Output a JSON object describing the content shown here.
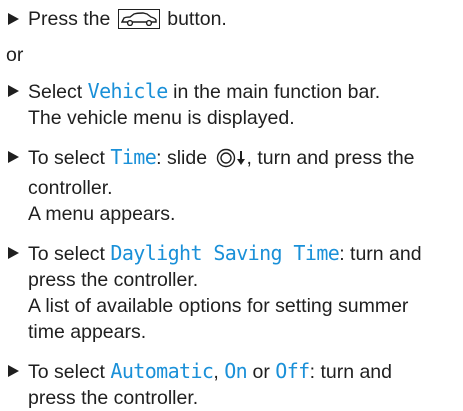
{
  "steps": [
    {
      "pre": "Press the",
      "post": "button.",
      "icon": "car-button-icon"
    },
    {
      "or_label": "or"
    },
    {
      "pre": "Select",
      "term": "Vehicle",
      "post": "in the main function bar.",
      "result": "The vehicle menu is displayed."
    },
    {
      "pre": "To select",
      "term": "Time",
      "mid": ": slide",
      "post": ", turn and press the",
      "cont": "controller.",
      "result": "A menu appears.",
      "icon": "controller-slide-down-icon"
    },
    {
      "pre": "To select",
      "term": "Daylight Saving Time",
      "post": ": turn and",
      "cont": "press the controller.",
      "result1": "A list of available options for setting summer",
      "result2": "time appears."
    },
    {
      "pre": "To select",
      "term1": "Automatic",
      "sep1": ",",
      "term2": "On",
      "sep2": "or",
      "term3": "Off",
      "post": ": turn and",
      "cont": "press the controller."
    }
  ],
  "colors": {
    "term": "#1a90d8",
    "text": "#1f1f1f"
  }
}
